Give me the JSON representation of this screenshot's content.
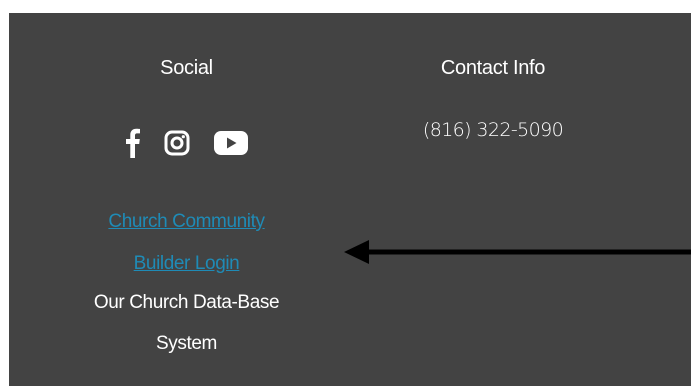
{
  "social": {
    "heading": "Social",
    "icons": [
      "facebook-icon",
      "instagram-icon",
      "youtube-icon"
    ],
    "link_line_1": "Church Community",
    "link_line_2": "Builder Login",
    "desc_line_1": "Our  Church Data-Base",
    "desc_line_2": "System"
  },
  "contact": {
    "heading": "Contact Info",
    "phone": "(816) 322-5090"
  },
  "colors": {
    "footer_bg": "#434343",
    "link": "#1f8bb6",
    "text": "#ffffff",
    "arrow": "#000000"
  }
}
